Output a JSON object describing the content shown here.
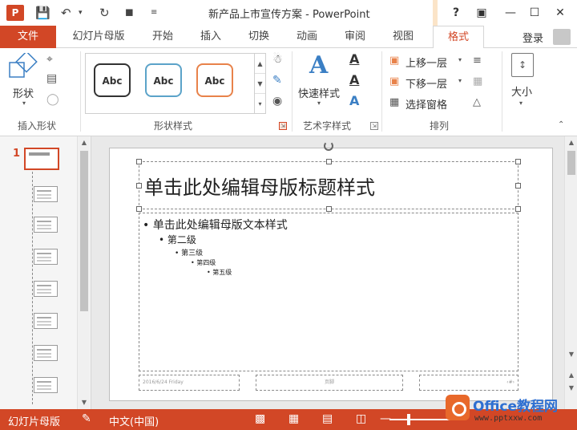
{
  "window": {
    "title": "新产品上市宣传方案 - PowerPoint",
    "help": "?",
    "buttons": [
      "restore",
      "minimize",
      "maximize",
      "close"
    ]
  },
  "tabs": [
    {
      "label": "文件",
      "kind": "file"
    },
    {
      "label": "幻灯片母版"
    },
    {
      "label": "开始"
    },
    {
      "label": "插入"
    },
    {
      "label": "切换"
    },
    {
      "label": "动画"
    },
    {
      "label": "审阅"
    },
    {
      "label": "视图"
    },
    {
      "label": "格式",
      "active": true
    }
  ],
  "account": {
    "login": "登录"
  },
  "ribbon": {
    "insert_shapes": {
      "shape_label": "形状",
      "group_label": "插入形状"
    },
    "shape_styles": {
      "samples": [
        "Abc",
        "Abc",
        "Abc"
      ],
      "group_label": "形状样式"
    },
    "art_text": {
      "quick_styles": "快速样式",
      "text_a": "A",
      "group_label": "艺术字样式"
    },
    "arrange": {
      "bring_forward": "上移一层",
      "send_backward": "下移一层",
      "selection_pane": "选择窗格",
      "group_label": "排列"
    },
    "size": {
      "label": "大小"
    }
  },
  "thumbnails": {
    "master_number": "1",
    "layout_count": 7
  },
  "slide": {
    "title_placeholder": "单击此处编辑母版标题样式",
    "levels": [
      "单击此处编辑母版文本样式",
      "第二级",
      "第三级",
      "第四级",
      "第五级"
    ],
    "footer_date": "2016/6/24 Friday",
    "footer_center": "页脚",
    "footer_number": "‹#›"
  },
  "status": {
    "view": "幻灯片母版",
    "language": "中文(中国)"
  },
  "watermark": {
    "brand": "Office教程网",
    "url": "www.pptxxw.com"
  },
  "colors": {
    "accent": "#d24726"
  }
}
